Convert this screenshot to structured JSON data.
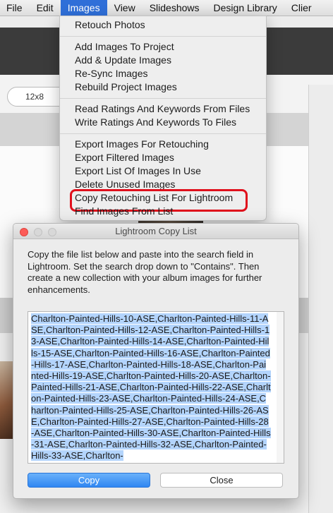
{
  "menubar": {
    "items": [
      "File",
      "Edit",
      "Images",
      "View",
      "Slideshows",
      "Design Library",
      "Clier"
    ],
    "active": "Images"
  },
  "toolbar": {
    "size_value": "12x8"
  },
  "images_menu": {
    "groups": [
      [
        "Retouch Photos"
      ],
      [
        "Add Images To Project",
        "Add & Update Images",
        "Re-Sync Images",
        "Rebuild Project Images"
      ],
      [
        "Read Ratings And Keywords From Files",
        "Write Ratings And Keywords To Files"
      ],
      [
        "Export Images For Retouching",
        "Export Filtered Images",
        "Export List Of Images In Use",
        "Delete Unused Images",
        "Copy Retouching List For Lightroom",
        "Find Images From List"
      ]
    ],
    "highlighted_item": "Copy Retouching List For Lightroom"
  },
  "dialog": {
    "title": "Lightroom Copy List",
    "instructions": "Copy the file list below and paste into the search field in Lightroom. Set the search drop down to \"Contains\". Then create a new collection with your album images for further enhancements.",
    "file_list": "Charlton-Painted-Hills-10-ASE,Charlton-Painted-Hills-11-ASE,Charlton-Painted-Hills-12-ASE,Charlton-Painted-Hills-13-ASE,Charlton-Painted-Hills-14-ASE,Charlton-Painted-Hills-15-ASE,Charlton-Painted-Hills-16-ASE,Charlton-Painted-Hills-17-ASE,Charlton-Painted-Hills-18-ASE,Charlton-Painted-Hills-19-ASE,Charlton-Painted-Hills-20-ASE,Charlton-Painted-Hills-21-ASE,Charlton-Painted-Hills-22-ASE,Charlton-Painted-Hills-23-ASE,Charlton-Painted-Hills-24-ASE,Charlton-Painted-Hills-25-ASE,Charlton-Painted-Hills-26-ASE,Charlton-Painted-Hills-27-ASE,Charlton-Painted-Hills-28-ASE,Charlton-Painted-Hills-30-ASE,Charlton-Painted-Hills-31-ASE,Charlton-Painted-Hills-32-ASE,Charlton-Painted-Hills-33-ASE,Charlton-",
    "copy_label": "Copy",
    "close_label": "Close"
  },
  "colors": {
    "accent": "#2f6fd8",
    "highlight_ring": "#e0101c",
    "selection": "#b3d4fc"
  }
}
